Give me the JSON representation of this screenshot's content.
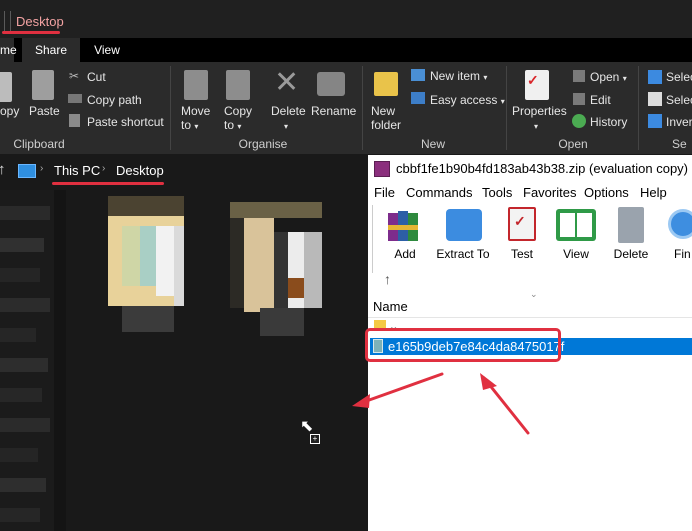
{
  "explorer": {
    "window_title": "Desktop",
    "tabs": [
      "me",
      "Share",
      "View"
    ],
    "ribbon": {
      "clipboard": {
        "copy_label": "opy",
        "paste_label": "Paste",
        "cut_label": "Cut",
        "copy_path_label": "Copy path",
        "paste_shortcut_label": "Paste shortcut",
        "group_label": "Clipboard"
      },
      "organise": {
        "move_to_label": "Move to",
        "copy_to_label": "Copy to",
        "delete_label": "Delete",
        "rename_label": "Rename",
        "group_label": "Organise"
      },
      "new": {
        "new_folder_label": "New folder",
        "new_item_label": "New item",
        "easy_access_label": "Easy access",
        "group_label": "New"
      },
      "open": {
        "properties_label": "Properties",
        "open_label": "Open",
        "edit_label": "Edit",
        "history_label": "History",
        "group_label": "Open"
      },
      "select": {
        "select_all_label": "Selec",
        "select_none_label": "Selec",
        "invert_label": "Inver",
        "group_label": "Se"
      }
    },
    "breadcrumb": [
      "This PC",
      "Desktop"
    ]
  },
  "winrar": {
    "title": "cbbf1fe1b90b4fd183ab43b38.zip (evaluation copy)",
    "menu": [
      "File",
      "Commands",
      "Tools",
      "Favorites",
      "Options",
      "Help"
    ],
    "toolbar": [
      "Add",
      "Extract To",
      "Test",
      "View",
      "Delete",
      "Fin"
    ],
    "list_header": "Name",
    "rows": [
      "..",
      "e165b9deb7e84c4da8475017f"
    ]
  },
  "colors": {
    "annotation_red": "#e03040",
    "selection_blue": "#0078d7",
    "explorer_bg": "#191919"
  }
}
